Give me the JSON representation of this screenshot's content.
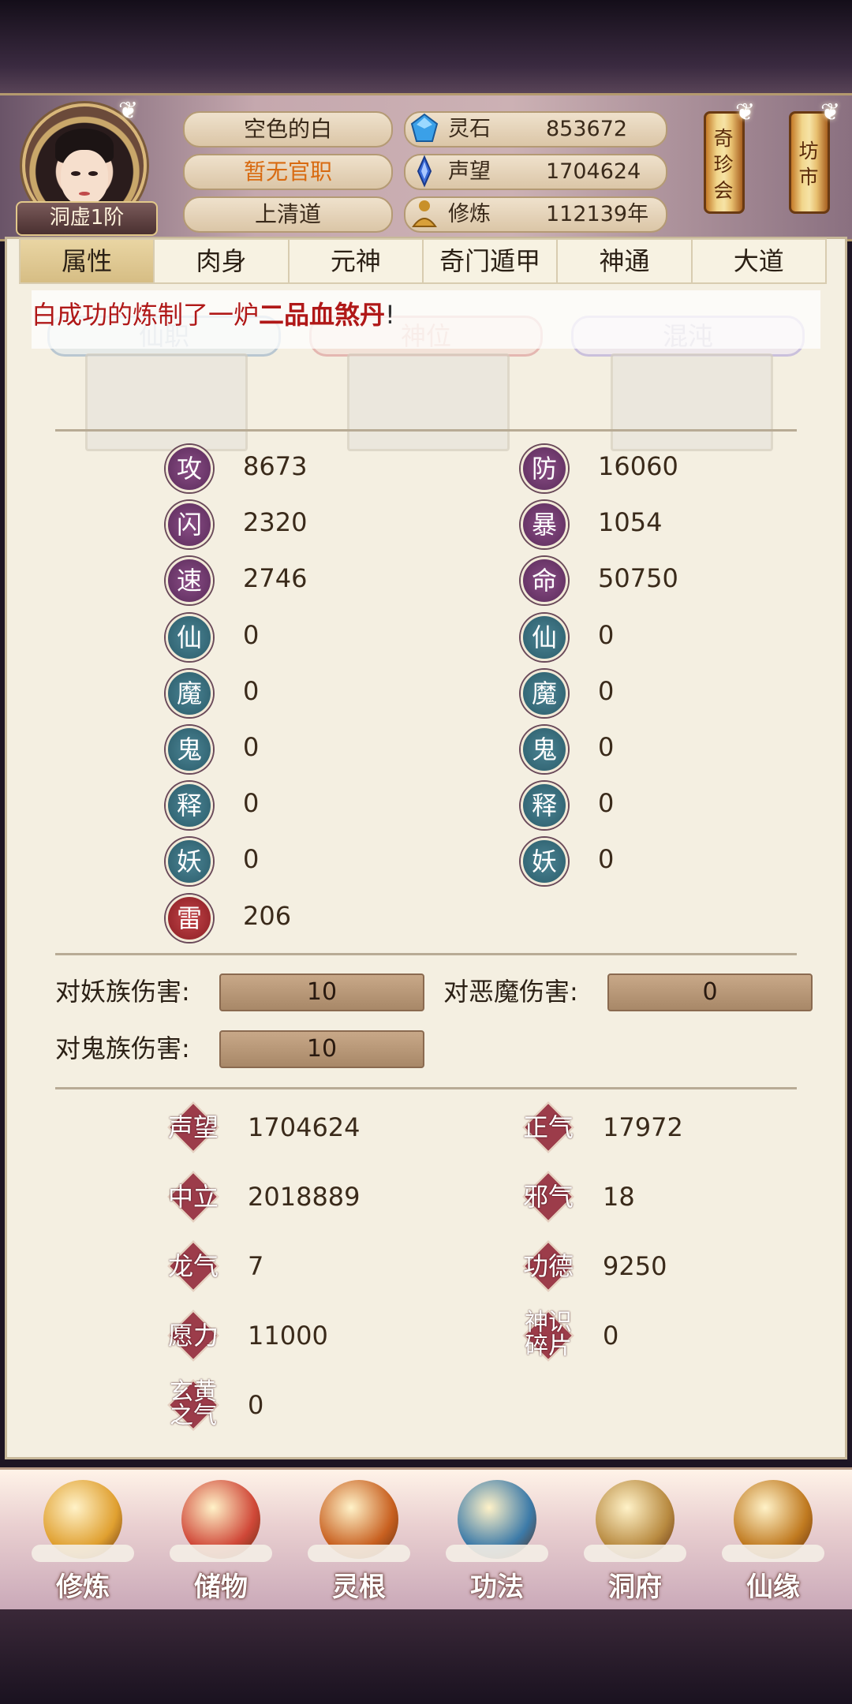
{
  "header": {
    "avatar_rank": "洞虚1阶",
    "name": "空色的白",
    "title": "暂无官职",
    "sect": "上清道",
    "resources": [
      {
        "icon": "spirit-stone-icon",
        "label": "灵石",
        "value": "853672"
      },
      {
        "icon": "reputation-icon",
        "label": "声望",
        "value": "1704624"
      },
      {
        "icon": "cultivation-icon",
        "label": "修炼",
        "value": "112139年"
      }
    ],
    "shortcuts": [
      {
        "label": "奇珍会"
      },
      {
        "label": "坊市"
      }
    ]
  },
  "tabs": [
    {
      "label": "属性",
      "active": true
    },
    {
      "label": "肉身"
    },
    {
      "label": "元神"
    },
    {
      "label": "奇门遁甲"
    },
    {
      "label": "神通"
    },
    {
      "label": "大道"
    }
  ],
  "notice": {
    "prefix": "白成功的炼制了一炉",
    "item": "二品血煞丹",
    "suffix": "!"
  },
  "slots": [
    {
      "label": "仙职"
    },
    {
      "label": "神位"
    },
    {
      "label": "混沌"
    }
  ],
  "attributes_left": [
    {
      "glyph": "攻",
      "value": "8673"
    },
    {
      "glyph": "闪",
      "value": "2320"
    },
    {
      "glyph": "速",
      "value": "2746"
    },
    {
      "glyph": "仙",
      "value": "0"
    },
    {
      "glyph": "魔",
      "value": "0"
    },
    {
      "glyph": "鬼",
      "value": "0"
    },
    {
      "glyph": "释",
      "value": "0"
    },
    {
      "glyph": "妖",
      "value": "0"
    },
    {
      "glyph": "雷",
      "value": "206"
    }
  ],
  "attributes_right": [
    {
      "glyph": "防",
      "value": "16060"
    },
    {
      "glyph": "暴",
      "value": "1054"
    },
    {
      "glyph": "命",
      "value": "50750"
    },
    {
      "glyph": "仙",
      "value": "0"
    },
    {
      "glyph": "魔",
      "value": "0"
    },
    {
      "glyph": "鬼",
      "value": "0"
    },
    {
      "glyph": "释",
      "value": "0"
    },
    {
      "glyph": "妖",
      "value": "0"
    }
  ],
  "damage": [
    {
      "label": "对妖族伤害:",
      "value": "10"
    },
    {
      "label": "对恶魔伤害:",
      "value": "0"
    },
    {
      "label": "对鬼族伤害:",
      "value": "10"
    }
  ],
  "morality_left": [
    {
      "label": "声望",
      "value": "1704624"
    },
    {
      "label": "中立",
      "value": "2018889"
    },
    {
      "label": "龙气",
      "value": "7"
    },
    {
      "label": "愿力",
      "value": "11000"
    },
    {
      "label": "玄黄之气",
      "value": "0"
    }
  ],
  "morality_right": [
    {
      "label": "正气",
      "value": "17972"
    },
    {
      "label": "邪气",
      "value": "18"
    },
    {
      "label": "功德",
      "value": "9250"
    },
    {
      "label": "神识碎片",
      "value": "0"
    }
  ],
  "bottom_nav": [
    {
      "label": "修炼",
      "icon": "meditation-icon",
      "color": "#e0a030"
    },
    {
      "label": "储物",
      "icon": "storage-bag-icon",
      "color": "#d04838"
    },
    {
      "label": "灵根",
      "icon": "spirit-root-icon",
      "color": "#c86020"
    },
    {
      "label": "功法",
      "icon": "scripture-book-icon",
      "color": "#3c7aa8"
    },
    {
      "label": "洞府",
      "icon": "cave-mansion-icon",
      "color": "#b88a40"
    },
    {
      "label": "仙缘",
      "icon": "gourd-icon",
      "color": "#c07a20"
    }
  ]
}
